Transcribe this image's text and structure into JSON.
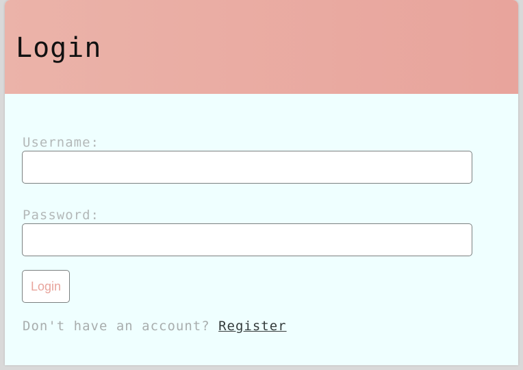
{
  "header": {
    "title": "Login"
  },
  "form": {
    "username_label": "Username:",
    "username_value": "",
    "password_label": "Password:",
    "password_value": "",
    "login_button_label": "Login"
  },
  "footer": {
    "prompt_text": "Don't have an account? ",
    "register_link_label": "Register"
  },
  "colors": {
    "header_gradient_start": "#ebb3a9",
    "header_gradient_end": "#e8a49c",
    "card_background": "#efffff",
    "page_background": "#d9d9d9",
    "button_text": "#e8a49c",
    "label_text": "#b3b8b8"
  }
}
